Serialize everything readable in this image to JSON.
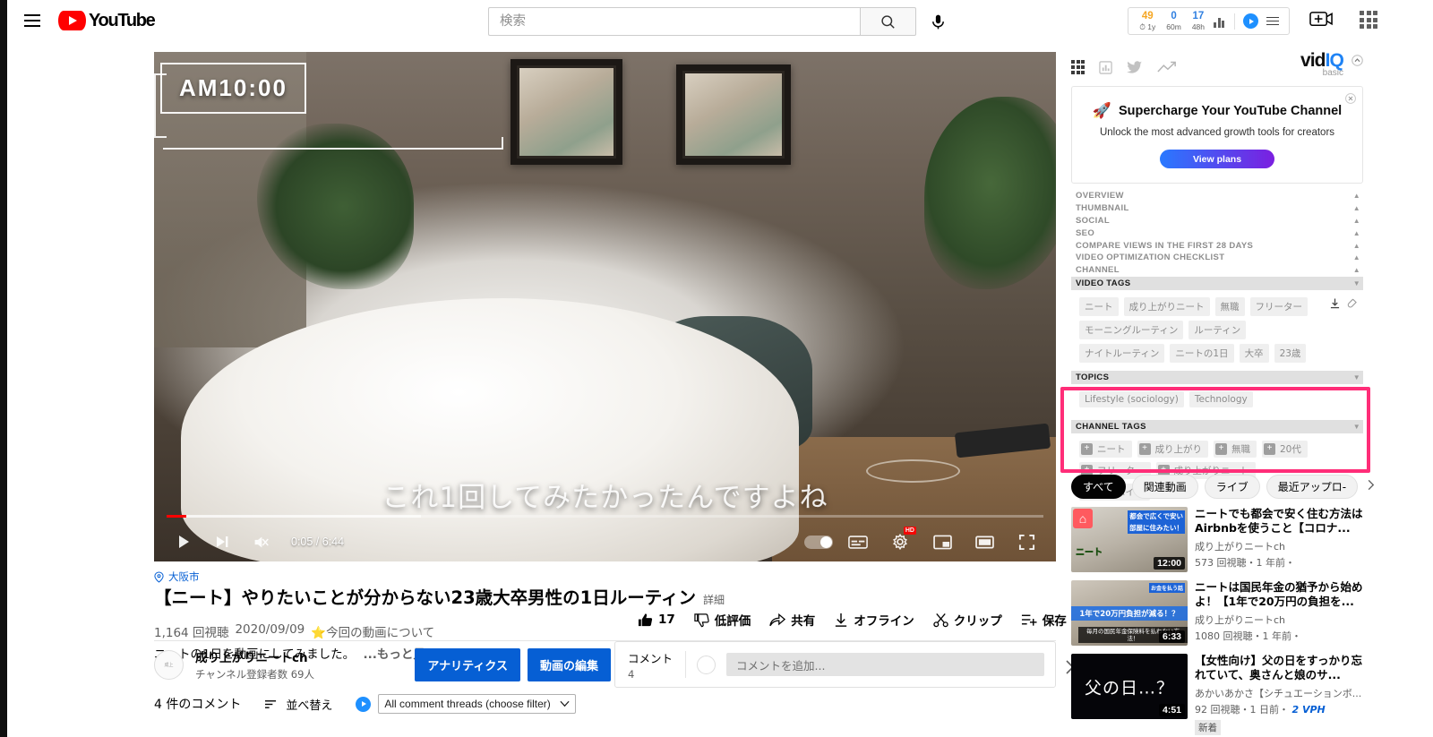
{
  "masthead": {
    "menu_icon": "hamburger-icon",
    "logo_text": "YouTube",
    "search_placeholder": "検索",
    "search_value": "",
    "search_icon": "search-icon",
    "mic_icon": "microphone-icon",
    "create_icon": "create-video-icon",
    "apps_icon": "apps-grid-icon"
  },
  "vidiq_stats": {
    "items": [
      {
        "num": "49",
        "sub": "1y",
        "color": "#f5a623"
      },
      {
        "num": "0",
        "sub": "60m",
        "color": "#2f7fe0"
      },
      {
        "num": "17",
        "sub": "48h",
        "color": "#2f7fe0"
      }
    ],
    "bars_icon": "bar-chart-icon",
    "vidiq_icon": "vidiq-logo-icon",
    "menu_icon": "vidiq-menu-icon"
  },
  "player": {
    "overlay_timestamp": "AM10:00",
    "caption": "これ1回してみたかったんですよね",
    "current_time": "0:05",
    "duration": "6:44",
    "time_display": "0:05 / 6:44",
    "play_icon": "play-icon",
    "next_icon": "next-video-icon",
    "volume_icon": "volume-muted-icon",
    "autoplay_icon": "autoplay-toggle",
    "subtitles_icon": "subtitles-icon",
    "settings_icon": "settings-gear-icon",
    "quality_badge": "HD",
    "miniplayer_icon": "miniplayer-icon",
    "theater_icon": "theater-mode-icon",
    "fullscreen_icon": "fullscreen-icon",
    "progress_percent": 2.2
  },
  "video": {
    "location_icon": "location-pin-icon",
    "location": "大阪市",
    "title": "【ニート】やりたいことが分からない23歳大卒男性の1日ルーティン",
    "detail_label": "詳細",
    "views": "1,164 回視聴",
    "date": "2020/09/09",
    "note": "⭐今回の動画について",
    "description": "ニートの1日を動画にしてみました。",
    "more_label": "...もっと見る",
    "actions": [
      {
        "icon": "thumbs-up-icon",
        "label": "17",
        "name": "like-button"
      },
      {
        "icon": "thumbs-down-icon",
        "label": "低評価",
        "name": "dislike-button"
      },
      {
        "icon": "share-icon",
        "label": "共有",
        "name": "share-button"
      },
      {
        "icon": "download-icon",
        "label": "オフライン",
        "name": "offline-button"
      },
      {
        "icon": "scissors-icon",
        "label": "クリップ",
        "name": "clip-button"
      },
      {
        "icon": "save-playlist-icon",
        "label": "保存",
        "name": "save-button"
      },
      {
        "icon": "more-options-icon",
        "label": "...",
        "name": "more-button"
      }
    ]
  },
  "channel": {
    "avatar_icon": "channel-avatar",
    "name": "成り上がりニートch",
    "subscribers": "チャンネル登録者数 69人",
    "analytics_label": "アナリティクス",
    "edit_label": "動画の編集"
  },
  "comment_card": {
    "label": "コメント",
    "count": "4",
    "avatar_icon": "user-avatar-icon",
    "placeholder": "コメントを追加...",
    "expand_icon": "chevron-right-icon"
  },
  "comments_bottom": {
    "count_label": "4 件のコメント",
    "sort_icon": "sort-icon",
    "sort_label": "並べ替え",
    "filter_icon": "vidiq-logo-icon",
    "filter_value": "All comment threads (choose filter)",
    "filter_caret": "chevron-down-icon"
  },
  "vidiq_panel": {
    "icons": [
      {
        "name": "grid-icon",
        "glyph": "grid"
      },
      {
        "name": "bar-chart-icon",
        "glyph": "bars"
      },
      {
        "name": "twitter-icon",
        "glyph": "twitter"
      },
      {
        "name": "trending-icon",
        "glyph": "trend"
      }
    ],
    "logo_main": "vidIQ",
    "logo_sub": "basic",
    "collapse_icon": "collapse-chevron-icon",
    "promo": {
      "close_icon": "close-icon",
      "rocket_icon": "rocket-icon",
      "title": "Supercharge Your YouTube Channel",
      "subtitle": "Unlock the most advanced growth tools for creators",
      "button_label": "View plans"
    },
    "sections": [
      {
        "label": "OVERVIEW",
        "header": false
      },
      {
        "label": "THUMBNAIL",
        "header": false
      },
      {
        "label": "SOCIAL",
        "header": false
      },
      {
        "label": "SEO",
        "header": false
      },
      {
        "label": "COMPARE VIEWS IN THE FIRST 28 DAYS",
        "header": false
      },
      {
        "label": "VIDEO OPTIMIZATION CHECKLIST",
        "header": false
      },
      {
        "label": "CHANNEL",
        "header": false
      }
    ],
    "video_tags_header": "VIDEO TAGS",
    "video_tags": [
      "ニート",
      "成り上がりニート",
      "無職",
      "フリーター",
      "モーニングルーティン",
      "ルーティン",
      "ナイトルーティン",
      "ニートの1日",
      "大卒",
      "23歳"
    ],
    "tag_download_icon": "download-tags-icon",
    "tag_copy_icon": "copy-tags-icon",
    "topics_header": "TOPICS",
    "topics": [
      "Lifestyle (sociology)",
      "Technology"
    ],
    "channel_tags_header": "CHANNEL TAGS",
    "channel_tags": [
      "ニート",
      "成り上がり",
      "無職",
      "20代",
      "フリーター",
      "成り上がりニート",
      "アルバイト"
    ],
    "highlight_color": "#ff2d78"
  },
  "filter_chips": {
    "items": [
      {
        "label": "すべて",
        "active": true
      },
      {
        "label": "関連動画",
        "active": false
      },
      {
        "label": "ライブ",
        "active": false
      },
      {
        "label": "最近アップロ-",
        "active": false
      }
    ],
    "next_icon": "chevron-right-icon"
  },
  "recommendations": [
    {
      "title": "ニートでも都会で安く住む方法はAirbnbを使うこと【コロナ...",
      "channel": "成り上がりニートch",
      "views": "573 回視聴・1 年前・",
      "duration": "12:00",
      "thumb_text_1": "都会で広くで安い",
      "thumb_text_2": "部屋に住みたい！",
      "thumb_text_3": "ニート",
      "vph": "",
      "badge": ""
    },
    {
      "title": "ニートは国民年金の猶予から始めよ！【1年で20万円の負担を...",
      "channel": "成り上がりニートch",
      "views": "1080 回視聴・1 年前・",
      "duration": "6:33",
      "thumb_text_1": "お金を払う話",
      "thumb_text_2": "1年で20万円負担が減る！？",
      "thumb_text_3": "毎月の国民年金保険料を払わない方法！",
      "vph": "",
      "badge": ""
    },
    {
      "title": "【女性向け】父の日をすっかり忘れていて、奥さんと娘のサ...",
      "channel": "あかいあかさ【シチュエーションボ...",
      "views": "92 回視聴・1 日前・",
      "duration": "4:51",
      "thumb_text_1": "父の日…？",
      "thumb_text_2": "",
      "thumb_text_3": "",
      "vph": "2 VPH",
      "badge": "新着"
    }
  ]
}
